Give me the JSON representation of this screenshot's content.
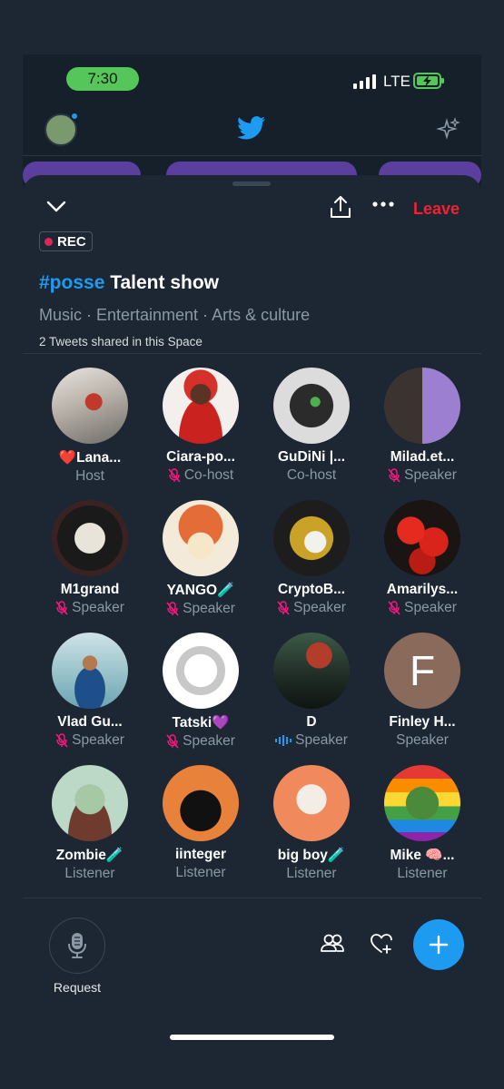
{
  "status": {
    "time": "7:30",
    "network": "LTE"
  },
  "space": {
    "rec_label": "REC",
    "title_tag": "#posse",
    "title_rest": " Talent show",
    "topics": "Music · Entertainment · Arts & culture",
    "shared": "2 Tweets shared in this Space",
    "leave_label": "Leave"
  },
  "participants": [
    {
      "name": "❤️Lana...",
      "role": "Host",
      "mic": "none",
      "avatar": "photo-woman-stairs"
    },
    {
      "name": "Ciara-po...",
      "role": "Co-host",
      "mic": "muted",
      "avatar": "photo-woman-red"
    },
    {
      "name": "GuDiNi |...",
      "role": "Co-host",
      "mic": "none",
      "avatar": "masked-figure"
    },
    {
      "name": "Milad.et...",
      "role": "Speaker",
      "mic": "muted",
      "avatar": "two-men"
    },
    {
      "name": "M1grand",
      "role": "Speaker",
      "mic": "muted",
      "avatar": "coin-face"
    },
    {
      "name": "YANGO🧪",
      "role": "Speaker",
      "mic": "muted",
      "avatar": "octopus-cartoon"
    },
    {
      "name": "CryptoB...",
      "role": "Speaker",
      "mic": "muted",
      "avatar": "leopard-dog"
    },
    {
      "name": "Amarilys...",
      "role": "Speaker",
      "mic": "muted",
      "avatar": "red-flowers"
    },
    {
      "name": "Vlad Gu...",
      "role": "Speaker",
      "mic": "muted",
      "avatar": "man-sitting"
    },
    {
      "name": "Tatski💜",
      "role": "Speaker",
      "mic": "muted",
      "avatar": "sketch-face"
    },
    {
      "name": "D",
      "role": "Speaker",
      "mic": "speaking",
      "avatar": "piano-girl"
    },
    {
      "name": "Finley H...",
      "role": "Speaker",
      "mic": "none",
      "avatar": "letter-f",
      "letter": "F"
    },
    {
      "name": "Zombie🧪",
      "role": "Listener",
      "mic": "none",
      "avatar": "zombie-cartoon"
    },
    {
      "name": "iinteger",
      "role": "Listener",
      "mic": "none",
      "avatar": "silhouette-orange"
    },
    {
      "name": "big boy🧪",
      "role": "Listener",
      "mic": "none",
      "avatar": "robot-peach"
    },
    {
      "name": "Mike 🧠...",
      "role": "Listener",
      "mic": "none",
      "avatar": "green-orc-rainbow"
    }
  ],
  "bottom": {
    "request_label": "Request"
  },
  "colors": {
    "accent": "#1d9bf0",
    "leave": "#f4212e",
    "muted": "#f91880",
    "speaking": "#1d9bf0",
    "bg": "#1c2733"
  }
}
